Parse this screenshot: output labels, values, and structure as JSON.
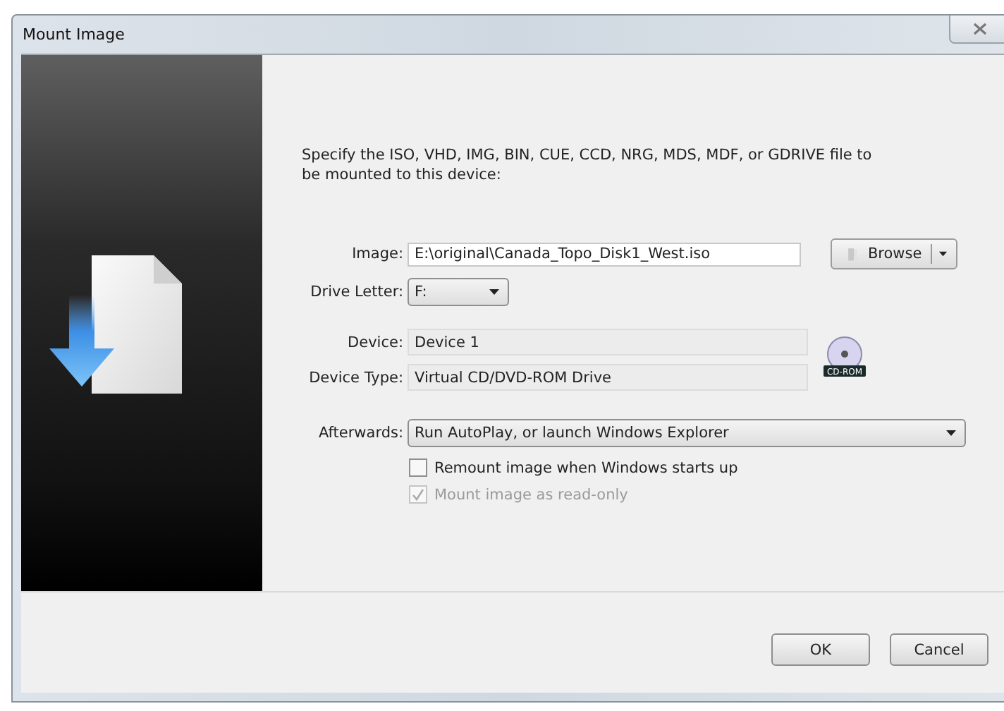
{
  "window": {
    "title": "Mount Image"
  },
  "description": "Specify the ISO, VHD, IMG, BIN, CUE, CCD, NRG, MDS, MDF, or GDRIVE file to be mounted to this device:",
  "image": {
    "label": "Image:",
    "value": "E:\\original\\Canada_Topo_Disk1_West.iso",
    "browse": "Browse"
  },
  "drive_letter": {
    "label": "Drive Letter:",
    "value": "F:"
  },
  "device": {
    "label": "Device:",
    "value": "Device 1"
  },
  "device_type": {
    "label": "Device Type:",
    "value": "Virtual CD/DVD-ROM Drive",
    "badge": "CD-ROM"
  },
  "afterwards": {
    "label": "Afterwards:",
    "value": "Run AutoPlay, or launch Windows Explorer"
  },
  "options": [
    {
      "label": "Remount image when Windows starts up",
      "checked": false,
      "disabled": false
    },
    {
      "label": "Mount image as read-only",
      "checked": true,
      "disabled": true
    }
  ],
  "buttons": [
    "OK",
    "Cancel"
  ]
}
